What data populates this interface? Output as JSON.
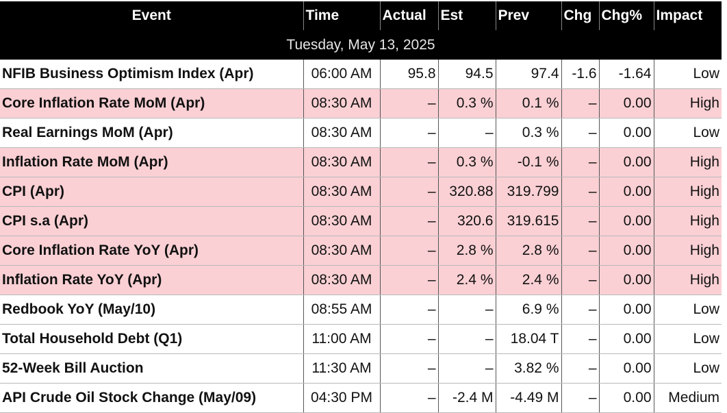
{
  "columns": [
    "Event",
    "Time",
    "Actual",
    "Est",
    "Prev",
    "Chg",
    "Chg%",
    "Impact"
  ],
  "date_label": "Tuesday, May 13, 2025",
  "rows": [
    {
      "event": "NFIB Business Optimism Index (Apr)",
      "time": "06:00 AM",
      "actual": "95.8",
      "est": "94.5",
      "prev": "97.4",
      "chg": "-1.6",
      "chg_pct": "-1.64",
      "impact": "Low"
    },
    {
      "event": "Core Inflation Rate MoM (Apr)",
      "time": "08:30 AM",
      "actual": "–",
      "est": "0.3 %",
      "prev": "0.1 %",
      "chg": "–",
      "chg_pct": "0.00",
      "impact": "High"
    },
    {
      "event": "Real Earnings MoM (Apr)",
      "time": "08:30 AM",
      "actual": "–",
      "est": "–",
      "prev": "0.3 %",
      "chg": "–",
      "chg_pct": "0.00",
      "impact": "Low"
    },
    {
      "event": "Inflation Rate MoM (Apr)",
      "time": "08:30 AM",
      "actual": "–",
      "est": "0.3 %",
      "prev": "-0.1 %",
      "chg": "–",
      "chg_pct": "0.00",
      "impact": "High"
    },
    {
      "event": "CPI (Apr)",
      "time": "08:30 AM",
      "actual": "–",
      "est": "320.88",
      "prev": "319.799",
      "chg": "–",
      "chg_pct": "0.00",
      "impact": "High"
    },
    {
      "event": "CPI s.a (Apr)",
      "time": "08:30 AM",
      "actual": "–",
      "est": "320.6",
      "prev": "319.615",
      "chg": "–",
      "chg_pct": "0.00",
      "impact": "High"
    },
    {
      "event": "Core Inflation Rate YoY (Apr)",
      "time": "08:30 AM",
      "actual": "–",
      "est": "2.8 %",
      "prev": "2.8 %",
      "chg": "–",
      "chg_pct": "0.00",
      "impact": "High"
    },
    {
      "event": "Inflation Rate YoY (Apr)",
      "time": "08:30 AM",
      "actual": "–",
      "est": "2.4 %",
      "prev": "2.4 %",
      "chg": "–",
      "chg_pct": "0.00",
      "impact": "High"
    },
    {
      "event": "Redbook YoY (May/10)",
      "time": "08:55 AM",
      "actual": "–",
      "est": "–",
      "prev": "6.9 %",
      "chg": "–",
      "chg_pct": "0.00",
      "impact": "Low"
    },
    {
      "event": "Total Household Debt (Q1)",
      "time": "11:00 AM",
      "actual": "–",
      "est": "–",
      "prev": "18.04 T",
      "chg": "–",
      "chg_pct": "0.00",
      "impact": "Low"
    },
    {
      "event": "52-Week Bill Auction",
      "time": "11:30 AM",
      "actual": "–",
      "est": "–",
      "prev": "3.82 %",
      "chg": "–",
      "chg_pct": "0.00",
      "impact": "Low"
    },
    {
      "event": "API Crude Oil Stock Change (May/09)",
      "time": "04:30 PM",
      "actual": "–",
      "est": "-2.4 M",
      "prev": "-4.49 M",
      "chg": "–",
      "chg_pct": "0.00",
      "impact": "Medium"
    }
  ],
  "colors": {
    "header_bg": "#000000",
    "high_row_bg": "#fad0d4",
    "normal_row_bg": "#ffffff"
  }
}
